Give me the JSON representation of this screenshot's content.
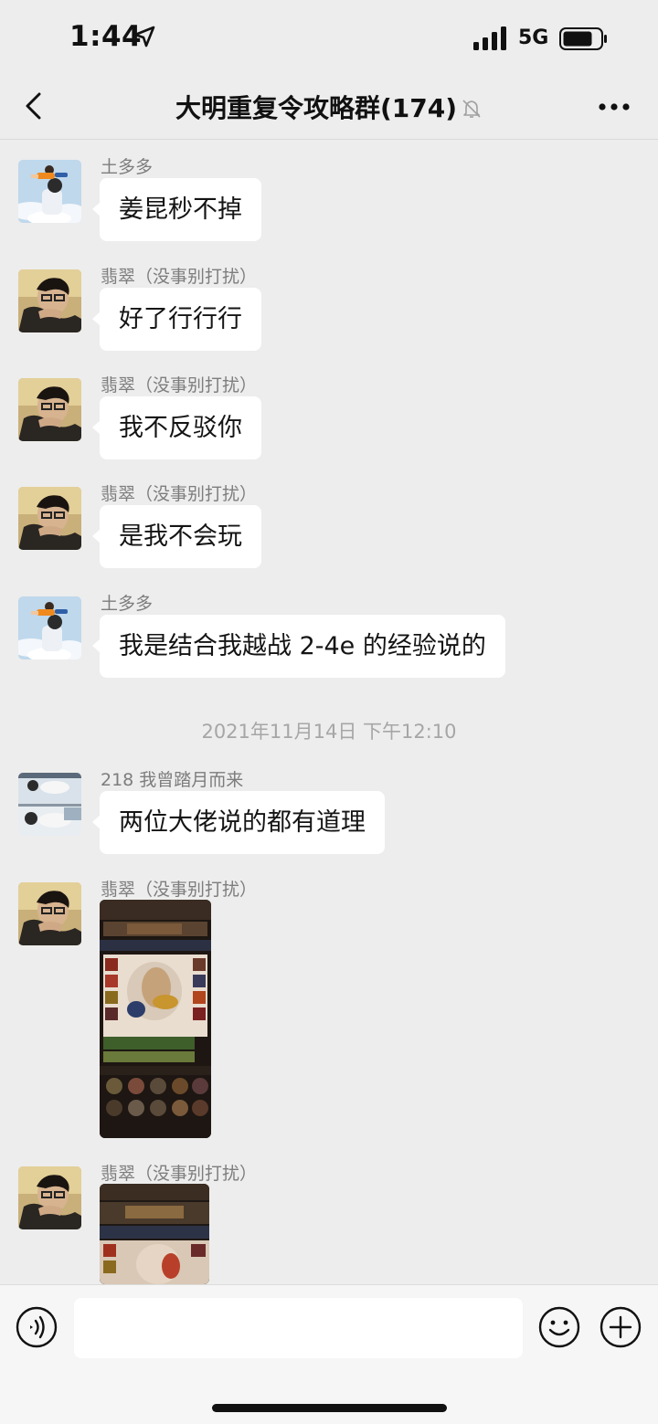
{
  "status_bar": {
    "time": "1:44",
    "network": "5G"
  },
  "header": {
    "title": "大明重复令攻略群(174)"
  },
  "messages": [
    {
      "sender": "土多多",
      "text": "姜昆秒不掉"
    },
    {
      "sender": "翡翠（没事别打扰）",
      "text": "好了行行行"
    },
    {
      "sender": "翡翠（没事别打扰）",
      "text": "我不反驳你"
    },
    {
      "sender": "翡翠（没事别打扰）",
      "text": "是我不会玩"
    },
    {
      "sender": "土多多",
      "text": "我是结合我越战 2-4e 的经验说的"
    },
    {
      "sender": "218 我曾踏月而来",
      "text": "两位大佬说的都有道理"
    },
    {
      "sender": "翡翠（没事别打扰）",
      "text": ""
    },
    {
      "sender": "翡翠（没事别打扰）",
      "text": ""
    }
  ],
  "timestamp": "2021年11月14日 下午12:10",
  "input": {
    "placeholder": ""
  },
  "colors": {
    "background": "#ededed",
    "bubble": "#ffffff",
    "sender": "#7d7d7d"
  }
}
